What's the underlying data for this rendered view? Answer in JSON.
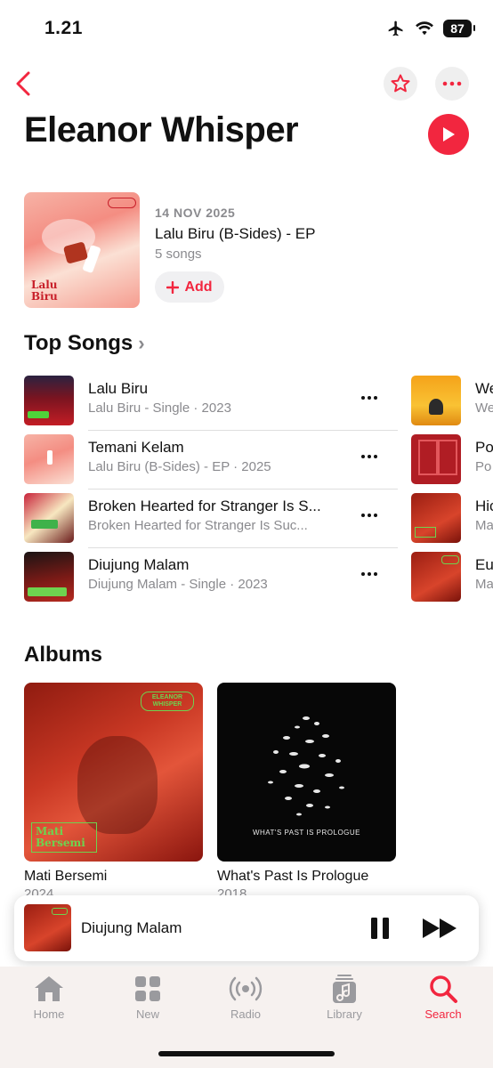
{
  "status_bar": {
    "time": "1.21",
    "battery": "87"
  },
  "artist": {
    "name": "Eleanor Whisper"
  },
  "latest_release": {
    "date": "14 NOV 2025",
    "title": "Lalu Biru (B-Sides) - EP",
    "count": "5 songs",
    "add_label": "Add",
    "art_text": "Lalu Biru"
  },
  "top_songs": {
    "title": "Top Songs",
    "items": [
      {
        "title": "Lalu Biru",
        "subtitle": "Lalu Biru - Single · 2023"
      },
      {
        "title": "Temani Kelam",
        "subtitle": "Lalu Biru (B-Sides) - EP · 2025"
      },
      {
        "title": "Broken Hearted for Stranger Is S...",
        "subtitle": "Broken Hearted for Stranger Is Suc..."
      },
      {
        "title": "Diujung Malam",
        "subtitle": "Diujung Malam - Single · 2023"
      }
    ],
    "peek": [
      {
        "title": "We",
        "subtitle": "We"
      },
      {
        "title": "Po",
        "subtitle": "Po"
      },
      {
        "title": "Hic",
        "subtitle": "Ma"
      },
      {
        "title": "Eu",
        "subtitle": "Ma"
      }
    ]
  },
  "albums": {
    "title": "Albums",
    "items": [
      {
        "title": "Mati Bersemi",
        "year": "2024",
        "art_text": "Mati Bersemi",
        "badge": "ELEANOR WHISPER"
      },
      {
        "title": "What's Past Is Prologue",
        "year": "2018",
        "art_text": "WHAT'S PAST IS PROLOGUE"
      }
    ]
  },
  "mini_player": {
    "title": "Diujung Malam"
  },
  "tab_bar": {
    "items": [
      {
        "label": "Home",
        "icon": "house-icon"
      },
      {
        "label": "New",
        "icon": "grid-icon"
      },
      {
        "label": "Radio",
        "icon": "radio-waves-icon"
      },
      {
        "label": "Library",
        "icon": "music-library-icon"
      },
      {
        "label": "Search",
        "icon": "search-icon",
        "active": true
      }
    ]
  },
  "colors": {
    "accent": "#f2263f",
    "secondary_text": "#8a8a8e"
  }
}
